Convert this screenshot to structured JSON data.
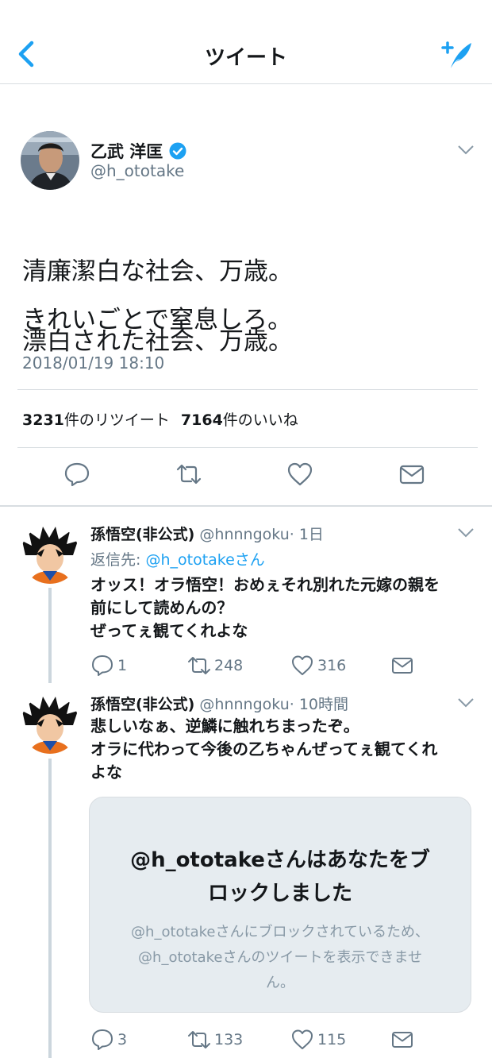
{
  "header": {
    "title": "ツイート",
    "back_icon": "chevron-left-icon",
    "compose_icon": "compose-tweet-icon",
    "accent": "#1da1f2"
  },
  "main_tweet": {
    "author_name": "乙武 洋匡",
    "author_handle": "@h_ototake",
    "verified": true,
    "text_line1": "清廉潔白な社会、万歳。",
    "text_line2": "漂白された社会、万歳。",
    "text_line3": "きれいごとで窒息しろ。",
    "timestamp": "2018/01/19 18:10",
    "retweet_count": "3231",
    "retweet_label": "件のリツイート",
    "like_count": "7164",
    "like_label": "件のいいね"
  },
  "replies": [
    {
      "author_name": "孫悟空(非公式)",
      "author_handle": "@hnnngoku",
      "time": "· 1日",
      "reply_to_prefix": "返信先: ",
      "reply_to_handle": "@h_ototakeさん",
      "body_line1": "オッス！オラ悟空！おめぇそれ別れた元嫁の親を",
      "body_line2": "前にして読めんの？",
      "body_line3": "ぜってぇ観てくれよな",
      "reply_count": "1",
      "retweet_count": "248",
      "like_count": "316"
    },
    {
      "author_name": "孫悟空(非公式)",
      "author_handle": "@hnnngoku",
      "time": "· 10時間",
      "body_line1": "悲しいなぁ、逆鱗に触れちまったぞ。",
      "body_line2": "オラに代わって今後の乙ちゃんぜってぇ観てくれ",
      "body_line3": "よな",
      "blocked_title_line1": "@h_ototakeさんはあなたをブ",
      "blocked_title_line2": "ロックしました",
      "blocked_desc_line1": "@h_ototakeさんにブロックされているため、",
      "blocked_desc_line2": "@h_ototakeさんのツイートを表示できませ",
      "blocked_desc_line3": "ん。",
      "reply_count": "3",
      "retweet_count": "133",
      "like_count": "115"
    }
  ]
}
